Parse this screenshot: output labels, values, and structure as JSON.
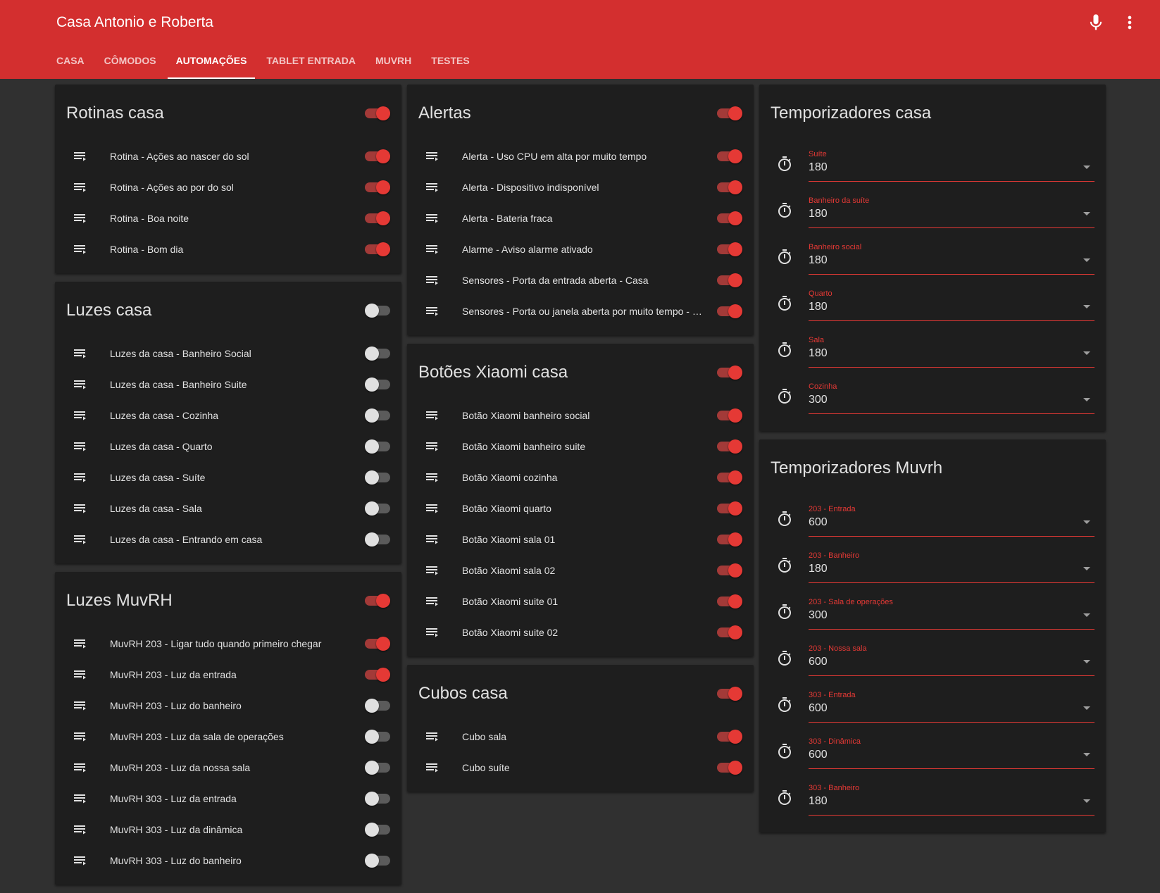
{
  "app": {
    "title": "Casa Antonio e Roberta"
  },
  "tabs": [
    {
      "label": "CASA"
    },
    {
      "label": "CÔMODOS"
    },
    {
      "label": "AUTOMAÇÕES"
    },
    {
      "label": "TABLET ENTRADA"
    },
    {
      "label": "MUVRH"
    },
    {
      "label": "TESTES"
    }
  ],
  "colors": {
    "accent": "#d32f2f",
    "toggle_on": "#e53935",
    "background": "#303030",
    "card": "#1e1e1e"
  },
  "cards": {
    "rotinas": {
      "title": "Rotinas casa",
      "on": true,
      "items": [
        {
          "label": "Rotina - Ações ao nascer do sol",
          "on": true
        },
        {
          "label": "Rotina - Ações ao por do sol",
          "on": true
        },
        {
          "label": "Rotina - Boa noite",
          "on": true
        },
        {
          "label": "Rotina - Bom dia",
          "on": true
        }
      ]
    },
    "luzes_casa": {
      "title": "Luzes casa",
      "on": false,
      "items": [
        {
          "label": "Luzes da casa - Banheiro Social",
          "on": false
        },
        {
          "label": "Luzes da casa - Banheiro Suite",
          "on": false
        },
        {
          "label": "Luzes da casa - Cozinha",
          "on": false
        },
        {
          "label": "Luzes da casa - Quarto",
          "on": false
        },
        {
          "label": "Luzes da casa - Suíte",
          "on": false
        },
        {
          "label": "Luzes da casa - Sala",
          "on": false
        },
        {
          "label": "Luzes da casa - Entrando em casa",
          "on": false
        }
      ]
    },
    "luzes_muvrh": {
      "title": "Luzes MuvRH",
      "on": true,
      "items": [
        {
          "label": "MuvRH 203 - Ligar tudo quando primeiro chegar",
          "on": true
        },
        {
          "label": "MuvRH 203 - Luz da entrada",
          "on": true
        },
        {
          "label": "MuvRH 203 - Luz do banheiro",
          "on": false
        },
        {
          "label": "MuvRH 203 - Luz da sala de operações",
          "on": false
        },
        {
          "label": "MuvRH 203 - Luz da nossa sala",
          "on": false
        },
        {
          "label": "MuvRH 303 - Luz da entrada",
          "on": false
        },
        {
          "label": "MuvRH 303 - Luz da dinâmica",
          "on": false
        },
        {
          "label": "MuvRH 303 - Luz do banheiro",
          "on": false
        }
      ]
    },
    "alertas": {
      "title": "Alertas",
      "on": true,
      "items": [
        {
          "label": "Alerta - Uso CPU em alta por muito tempo",
          "on": true
        },
        {
          "label": "Alerta - Dispositivo indisponível",
          "on": true
        },
        {
          "label": "Alerta - Bateria fraca",
          "on": true
        },
        {
          "label": "Alarme - Aviso alarme ativado",
          "on": true
        },
        {
          "label": "Sensores - Porta da entrada aberta - Casa",
          "on": true
        },
        {
          "label": "Sensores - Porta ou janela aberta por muito tempo - Ca...",
          "on": true
        }
      ]
    },
    "botoes": {
      "title": "Botões Xiaomi casa",
      "on": true,
      "items": [
        {
          "label": "Botão Xiaomi banheiro social",
          "on": true
        },
        {
          "label": "Botão Xiaomi banheiro suite",
          "on": true
        },
        {
          "label": "Botão Xiaomi cozinha",
          "on": true
        },
        {
          "label": "Botão Xiaomi quarto",
          "on": true
        },
        {
          "label": "Botão Xiaomi sala 01",
          "on": true
        },
        {
          "label": "Botão Xiaomi sala 02",
          "on": true
        },
        {
          "label": "Botão Xiaomi suite 01",
          "on": true
        },
        {
          "label": "Botão Xiaomi suite 02",
          "on": true
        }
      ]
    },
    "cubos": {
      "title": "Cubos casa",
      "on": true,
      "items": [
        {
          "label": "Cubo sala",
          "on": true
        },
        {
          "label": "Cubo suíte",
          "on": true
        }
      ]
    },
    "temp_casa": {
      "title": "Temporizadores casa",
      "items": [
        {
          "label": "Suíte",
          "value": "180"
        },
        {
          "label": "Banheiro da suíte",
          "value": "180"
        },
        {
          "label": "Banheiro social",
          "value": "180"
        },
        {
          "label": "Quarto",
          "value": "180"
        },
        {
          "label": "Sala",
          "value": "180"
        },
        {
          "label": "Cozinha",
          "value": "300"
        }
      ]
    },
    "temp_muvrh": {
      "title": "Temporizadores Muvrh",
      "items": [
        {
          "label": "203 - Entrada",
          "value": "600"
        },
        {
          "label": "203 - Banheiro",
          "value": "180"
        },
        {
          "label": "203 - Sala de operações",
          "value": "300"
        },
        {
          "label": "203 - Nossa sala",
          "value": "600"
        },
        {
          "label": "303 - Entrada",
          "value": "600"
        },
        {
          "label": "303 - Dinâmica",
          "value": "600"
        },
        {
          "label": "303 - Banheiro",
          "value": "180"
        }
      ]
    }
  }
}
